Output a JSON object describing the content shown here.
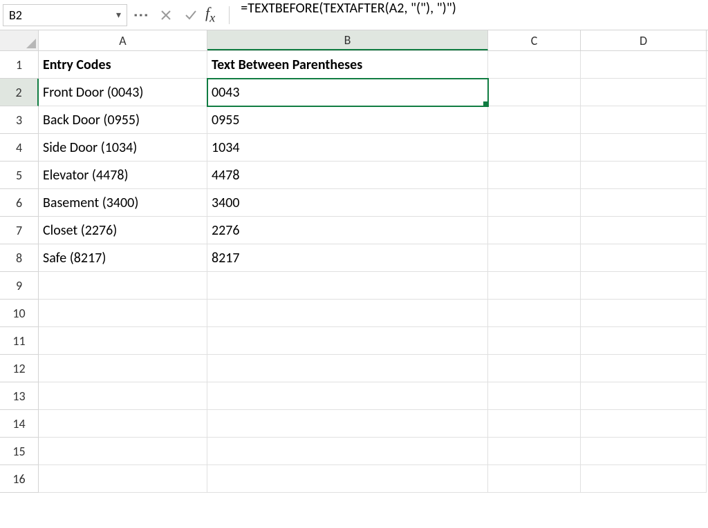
{
  "nameBox": "B2",
  "formula": "=TEXTBEFORE(TEXTAFTER(A2, \"(\"), \")\")",
  "columns": [
    "A",
    "B",
    "C",
    "D"
  ],
  "activeCol": "B",
  "activeRow": "2",
  "headers": {
    "A": "Entry Codes",
    "B": "Text Between Parentheses"
  },
  "rows": [
    {
      "n": "2",
      "A": "Front Door (0043)",
      "B": "0043"
    },
    {
      "n": "3",
      "A": "Back Door (0955)",
      "B": "0955"
    },
    {
      "n": "4",
      "A": "Side Door (1034)",
      "B": "1034"
    },
    {
      "n": "5",
      "A": "Elevator (4478)",
      "B": "4478"
    },
    {
      "n": "6",
      "A": "Basement (3400)",
      "B": "3400"
    },
    {
      "n": "7",
      "A": "Closet (2276)",
      "B": "2276"
    },
    {
      "n": "8",
      "A": "Safe (8217)",
      "B": "8217"
    },
    {
      "n": "9",
      "A": "",
      "B": ""
    },
    {
      "n": "10",
      "A": "",
      "B": ""
    },
    {
      "n": "11",
      "A": "",
      "B": ""
    },
    {
      "n": "12",
      "A": "",
      "B": ""
    },
    {
      "n": "13",
      "A": "",
      "B": ""
    },
    {
      "n": "14",
      "A": "",
      "B": ""
    },
    {
      "n": "15",
      "A": "",
      "B": ""
    },
    {
      "n": "16",
      "A": "",
      "B": ""
    }
  ]
}
